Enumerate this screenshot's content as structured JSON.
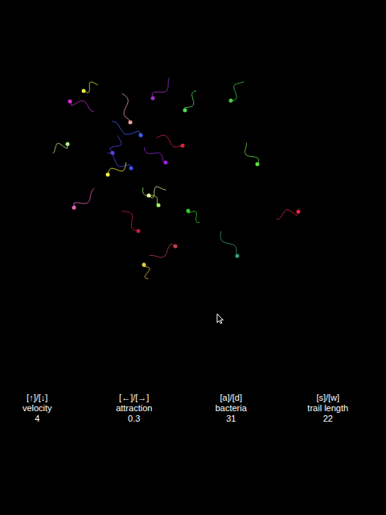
{
  "controls": [
    {
      "keys": "[↑]/[↓]",
      "label": "velocity",
      "value": "4"
    },
    {
      "keys": "[←]/[→]",
      "label": "attraction",
      "value": "0.3"
    },
    {
      "keys": "[a]/[d]",
      "label": "bacteria",
      "value": "31"
    },
    {
      "keys": "[s]/[w]",
      "label": "trail length",
      "value": "22"
    }
  ],
  "bacteria": [
    {
      "color": "#e8e84a"
    },
    {
      "color": "#d22fd2"
    },
    {
      "color": "#f0a0a0"
    },
    {
      "color": "#a030d0"
    },
    {
      "color": "#50e050"
    },
    {
      "color": "#40d040"
    },
    {
      "color": "#4060ff"
    },
    {
      "color": "#e02040"
    },
    {
      "color": "#b0f080"
    },
    {
      "color": "#a020e0"
    },
    {
      "color": "#60e040"
    },
    {
      "color": "#4050f0"
    },
    {
      "color": "#f0f040"
    },
    {
      "color": "#f060c0"
    },
    {
      "color": "#a0f060"
    },
    {
      "color": "#f0f0a0"
    },
    {
      "color": "#30d030"
    },
    {
      "color": "#c02040"
    },
    {
      "color": "#f02040"
    },
    {
      "color": "#30a080"
    },
    {
      "color": "#c04050"
    },
    {
      "color": "#e0d040"
    },
    {
      "color": "#6040e0"
    }
  ]
}
